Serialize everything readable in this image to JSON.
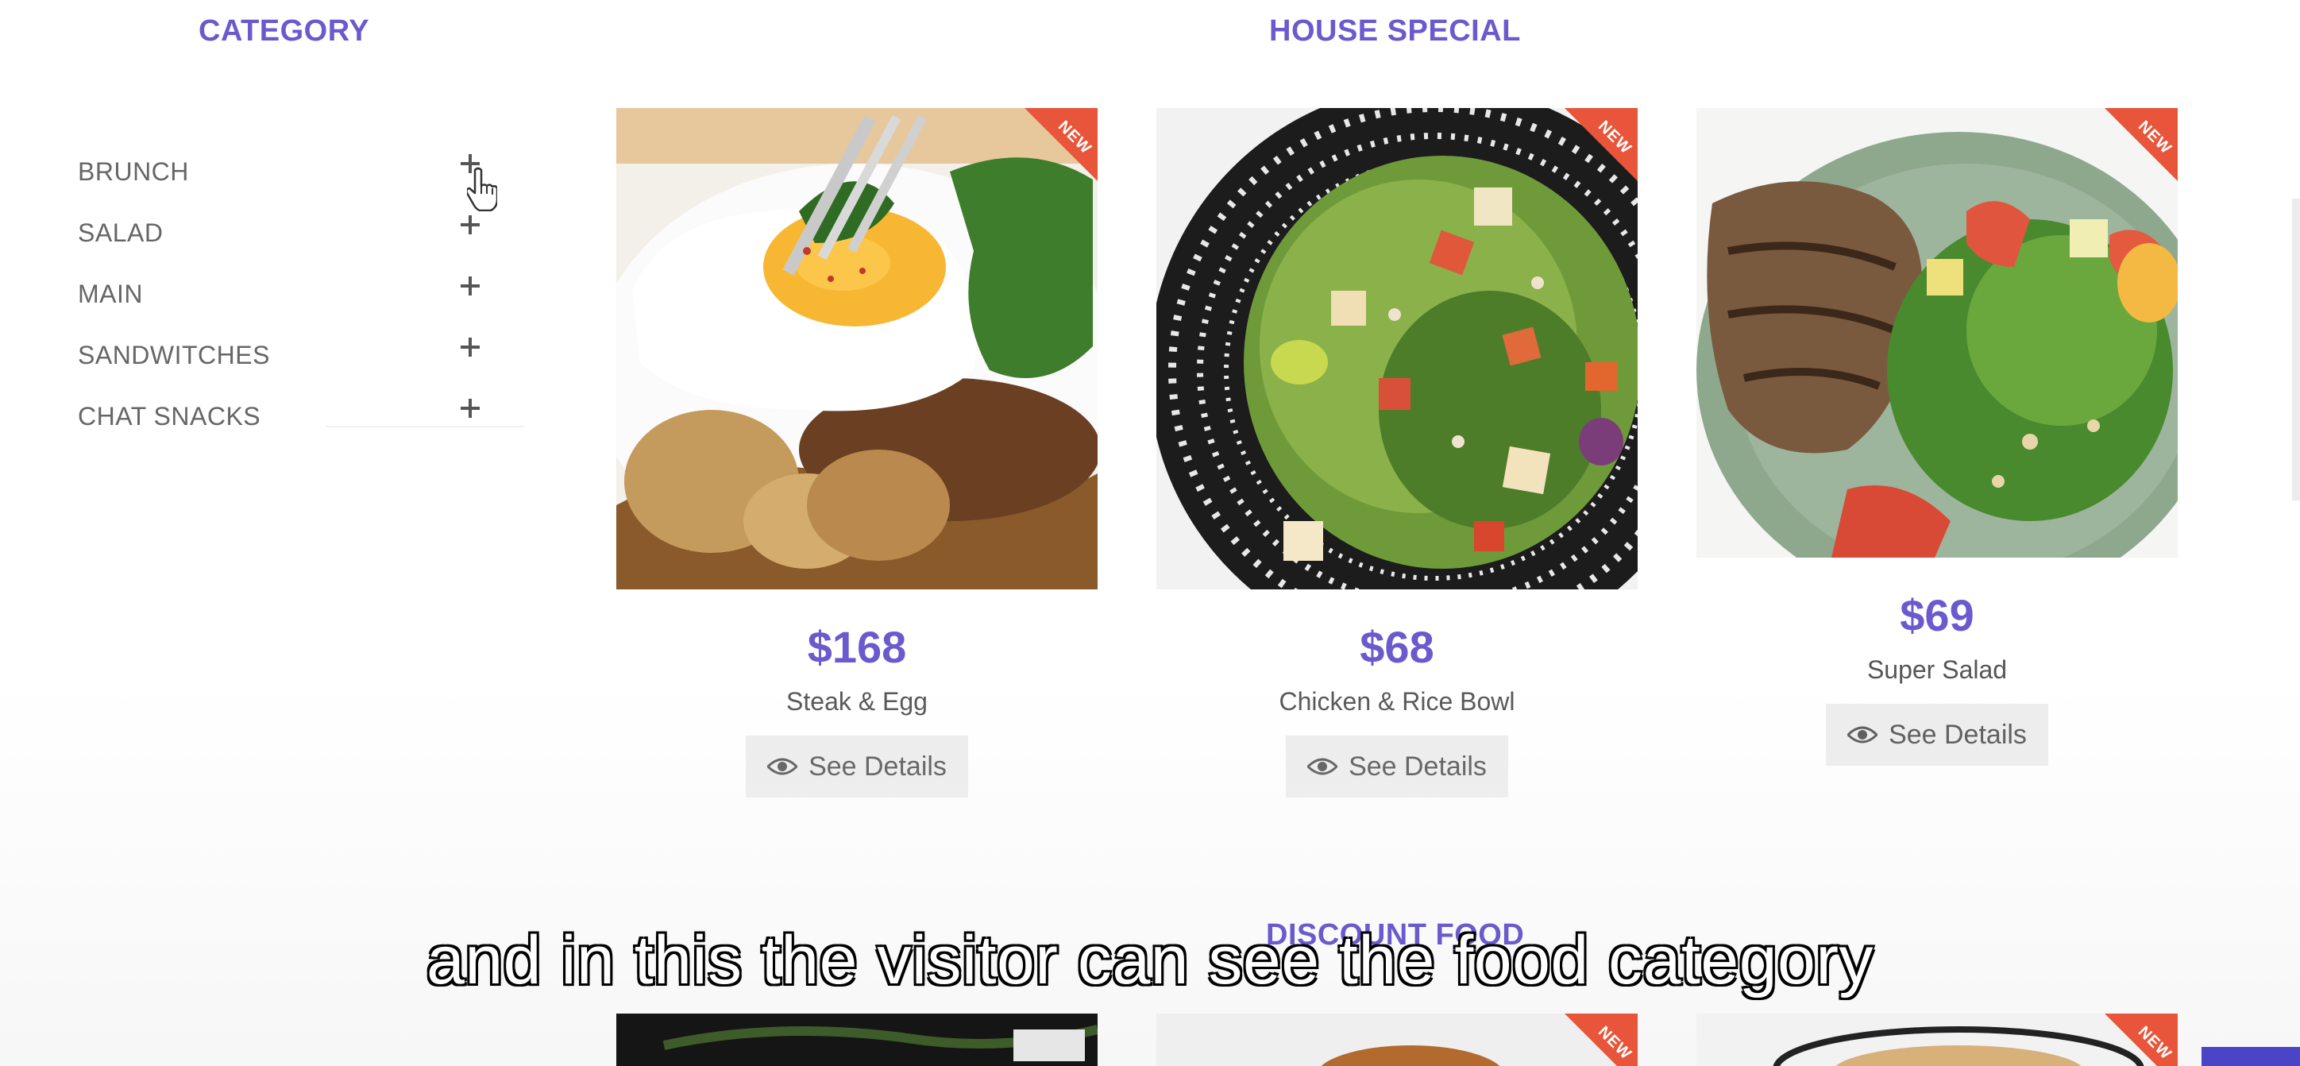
{
  "sections": {
    "category_title": "CATEGORY",
    "house_special_title": "HOUSE SPECIAL",
    "discount_title": "DISCOUNT FOOD"
  },
  "categories": [
    {
      "label": "BRUNCH"
    },
    {
      "label": "SALAD"
    },
    {
      "label": "MAIN"
    },
    {
      "label": "SANDWITCHES"
    },
    {
      "label": "CHAT SNACKS"
    }
  ],
  "products": [
    {
      "price": "$168",
      "name": "Steak & Egg",
      "badge": "NEW",
      "button": "See Details"
    },
    {
      "price": "$68",
      "name": "Chicken & Rice Bowl",
      "badge": "NEW",
      "button": "See Details"
    },
    {
      "price": "$69",
      "name": "Super Salad",
      "badge": "NEW",
      "button": "See Details"
    }
  ],
  "discount_badges": [
    "NEW",
    "NEW"
  ],
  "subtitle": "and in this the visitor can see the food category",
  "colors": {
    "accent": "#6a5acd",
    "ribbon": "#e8553a",
    "button_bg": "#ededed"
  }
}
